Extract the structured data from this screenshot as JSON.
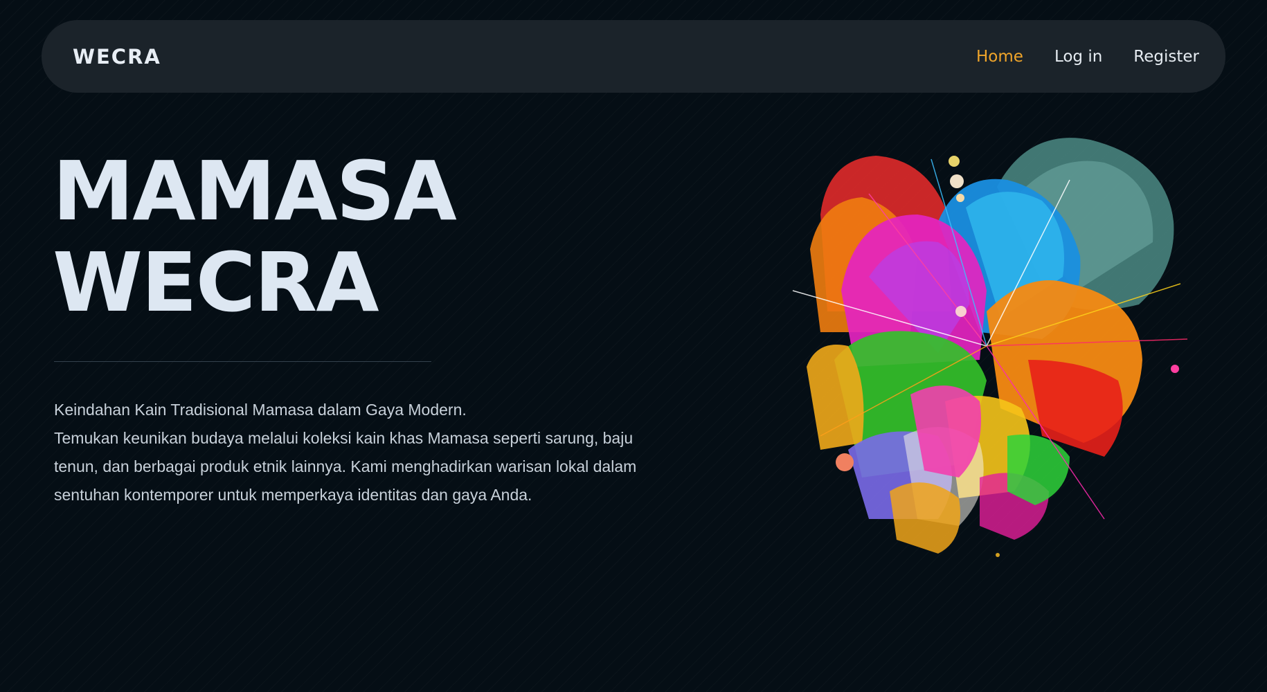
{
  "nav": {
    "brand": "WECRA",
    "links": [
      {
        "label": "Home",
        "active": true
      },
      {
        "label": "Log in",
        "active": false
      },
      {
        "label": "Register",
        "active": false
      }
    ]
  },
  "hero": {
    "title_line1": "MAMASA",
    "title_line2": "WECRA",
    "tagline": "Keindahan Kain Tradisional Mamasa dalam Gaya Modern.",
    "description": "Temukan keunikan budaya melalui koleksi kain khas Mamasa seperti sarung, baju tenun, dan berbagai produk etnik lainnya. Kami menghadirkan warisan lokal dalam sentuhan kontemporer untuk memperkaya identitas dan gaya Anda."
  },
  "colors": {
    "background": "#050e15",
    "navbar": "#1b232a",
    "accent": "#f0a52a",
    "title": "#dde7f2",
    "body_text": "#c8d1da"
  },
  "illustration": {
    "icon": "colorful-abstract-burst-illustration"
  }
}
